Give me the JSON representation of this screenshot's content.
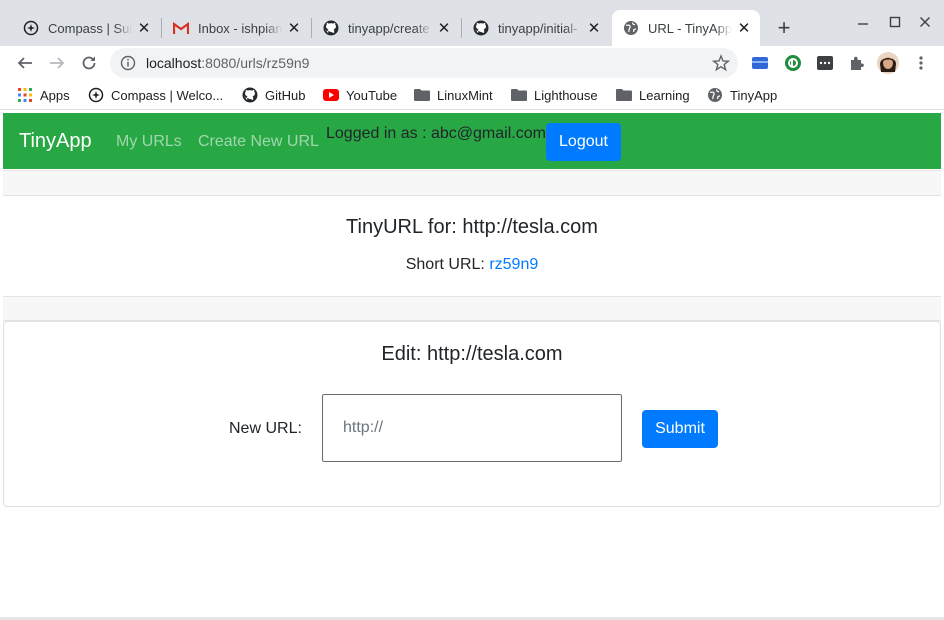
{
  "browser": {
    "tabs": [
      {
        "title": "Compass | Sub",
        "icon": "compass-icon",
        "active": false
      },
      {
        "title": "Inbox - ishpiam",
        "icon": "gmail-icon",
        "active": false
      },
      {
        "title": "tinyapp/create",
        "icon": "github-icon",
        "active": false
      },
      {
        "title": "tinyapp/initial-",
        "icon": "github-icon",
        "active": false
      },
      {
        "title": "URL - TinyApp",
        "icon": "globe-icon",
        "active": true
      }
    ],
    "close_glyph": "✕",
    "new_tab_glyph": "+",
    "address": {
      "host": "localhost",
      "path": ":8080/urls/rz59n9"
    },
    "bookmarks": [
      {
        "label": "Apps",
        "icon": "apps-grid-icon"
      },
      {
        "label": "Compass | Welco...",
        "icon": "compass-icon"
      },
      {
        "label": "GitHub",
        "icon": "github-icon"
      },
      {
        "label": "YouTube",
        "icon": "youtube-icon"
      },
      {
        "label": "LinuxMint",
        "icon": "folder-icon"
      },
      {
        "label": "Lighthouse",
        "icon": "folder-icon"
      },
      {
        "label": "Learning",
        "icon": "folder-icon"
      },
      {
        "label": "TinyApp",
        "icon": "globe-icon"
      }
    ]
  },
  "navbar": {
    "brand": "TinyApp",
    "links": [
      "My URLs",
      "Create New URL"
    ],
    "logged_in": "Logged in as : abc@gmail.com",
    "logout": "Logout",
    "color": "#28a745"
  },
  "tinyurl": {
    "title": "TinyURL for: http://tesla.com",
    "short_label": "Short URL:",
    "short_code": "rz59n9"
  },
  "edit": {
    "title": "Edit: http://tesla.com",
    "new_url_label": "New URL:",
    "placeholder": "http://",
    "submit": "Submit"
  },
  "colors": {
    "primary": "#007bff",
    "success": "#28a745"
  }
}
